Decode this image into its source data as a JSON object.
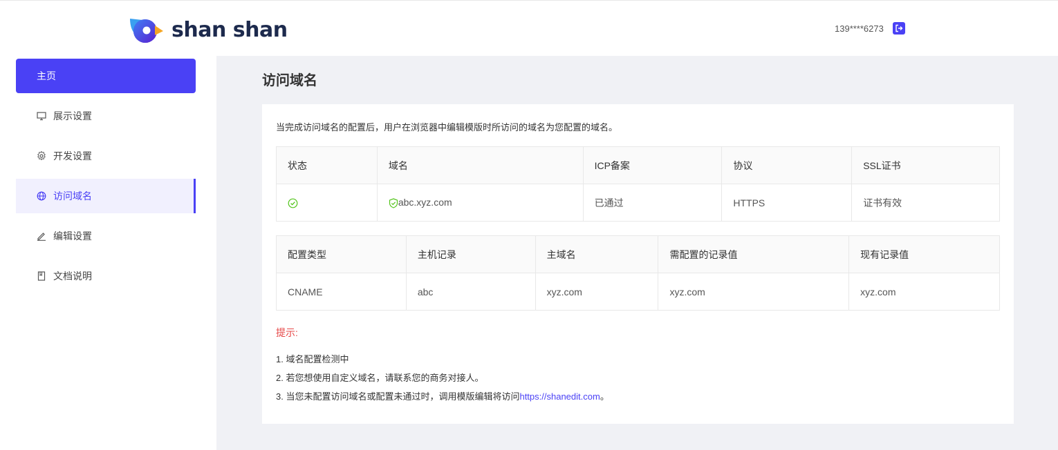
{
  "header": {
    "brand": "shan shan",
    "user_phone": "139****6273",
    "logout_icon": "logout-icon"
  },
  "sidebar": {
    "items": [
      {
        "label": "主页",
        "icon": ""
      },
      {
        "label": "展示设置",
        "icon": "monitor-icon"
      },
      {
        "label": "开发设置",
        "icon": "gear-icon"
      },
      {
        "label": "访问域名",
        "icon": "globe-icon"
      },
      {
        "label": "编辑设置",
        "icon": "pencil-icon"
      },
      {
        "label": "文档说明",
        "icon": "book-icon"
      }
    ]
  },
  "main": {
    "title": "访问域名",
    "description": "当完成访问域名的配置后，用户在浏览器中编辑模版时所访问的域名为您配置的域名。",
    "status_table": {
      "headers": [
        "状态",
        "域名",
        "ICP备案",
        "协议",
        "SSL证书"
      ],
      "row": {
        "domain": "abc.xyz.com",
        "icp": "已通过",
        "protocol": "HTTPS",
        "ssl": "证书有效"
      }
    },
    "config_table": {
      "headers": [
        "配置类型",
        "主机记录",
        "主域名",
        "需配置的记录值",
        "现有记录值"
      ],
      "row": [
        "CNAME",
        "abc",
        "xyz.com",
        "xyz.com",
        "xyz.com"
      ]
    },
    "tips": {
      "title": "提示:",
      "items": [
        "1. 域名配置检测中",
        "2. 若您想使用自定义域名，请联系您的商务对接人。"
      ],
      "item3_prefix": "3. 当您未配置访问域名或配置未通过时，调用模版编辑将访问",
      "item3_link": "https://shanedit.com",
      "item3_suffix": "。"
    }
  },
  "colors": {
    "accent": "#4a41f5",
    "success": "#52c41a",
    "warning": "#e64545",
    "background": "#f0f1f5"
  }
}
